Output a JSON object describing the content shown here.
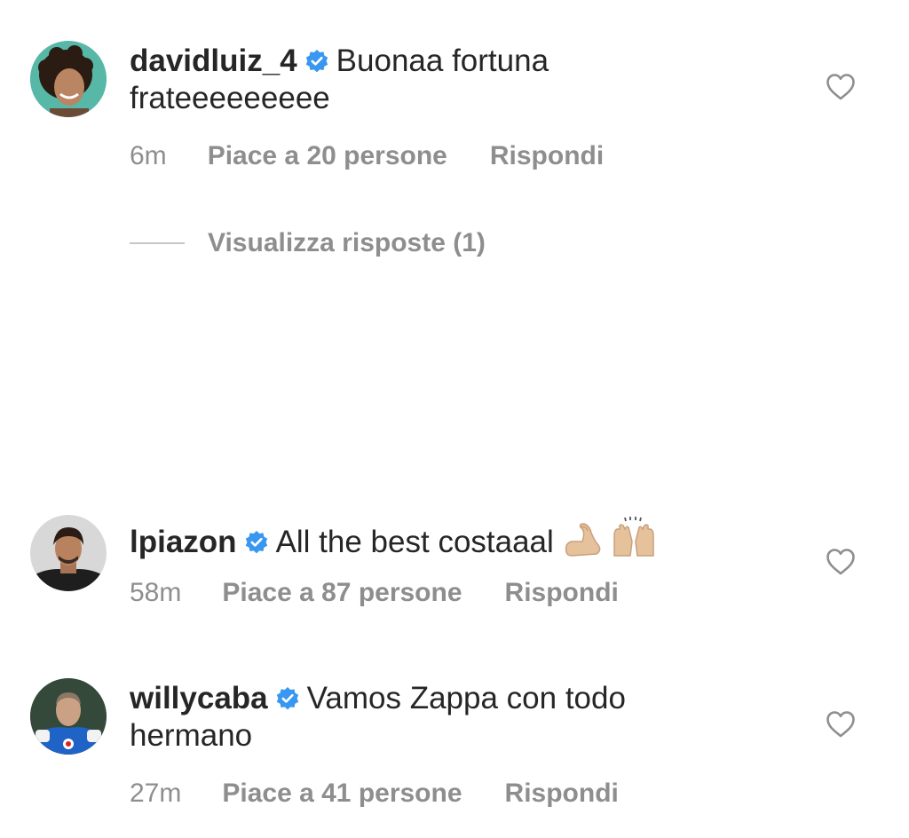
{
  "comments": [
    {
      "username": "davidluiz_4",
      "text_line1": "Buonaa fortuna",
      "text_line2": "frateeeeeeeee",
      "time": "6m",
      "likes": "Piace a 20 persone",
      "reply": "Rispondi",
      "view_replies": "Visualizza risposte (1)"
    },
    {
      "username": "lpiazon",
      "text_line1": "All the best costaaal",
      "emojis": [
        "flexed-biceps-icon",
        "raising-hands-icon"
      ],
      "time": "58m",
      "likes": "Piace a 87 persone",
      "reply": "Rispondi"
    },
    {
      "username": "willycaba",
      "text_line1": "Vamos Zappa con todo",
      "text_line2": "hermano",
      "time": "27m",
      "likes": "Piace a 41 persone",
      "reply": "Rispondi"
    }
  ],
  "colors": {
    "text": "#262626",
    "secondary": "#8e8e8e",
    "verified_blue": "#3897f0",
    "divider": "#c7c7c7"
  }
}
